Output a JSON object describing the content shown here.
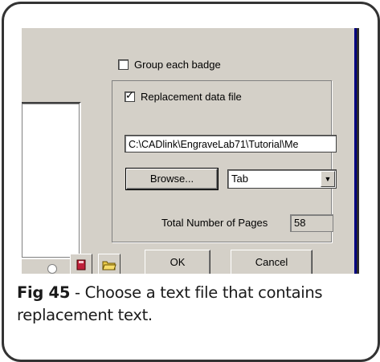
{
  "dialog": {
    "group_each_badge": {
      "label": "Group each badge",
      "checked": false
    },
    "replacement_data_file": {
      "label": "Replacement data file",
      "checked": true
    },
    "file_path": "C:\\CADlink\\EngraveLab71\\Tutorial\\Me",
    "browse_label": "Browse...",
    "delimiter": {
      "selected": "Tab"
    },
    "total_pages_label": "Total Number of Pages",
    "total_pages_value": "58",
    "ok_label": "OK",
    "cancel_label": "Cancel",
    "check_glyph": "✓"
  },
  "caption": {
    "fig_label": "Fig 45",
    "text": " - Choose a text file that contains replacement text."
  }
}
